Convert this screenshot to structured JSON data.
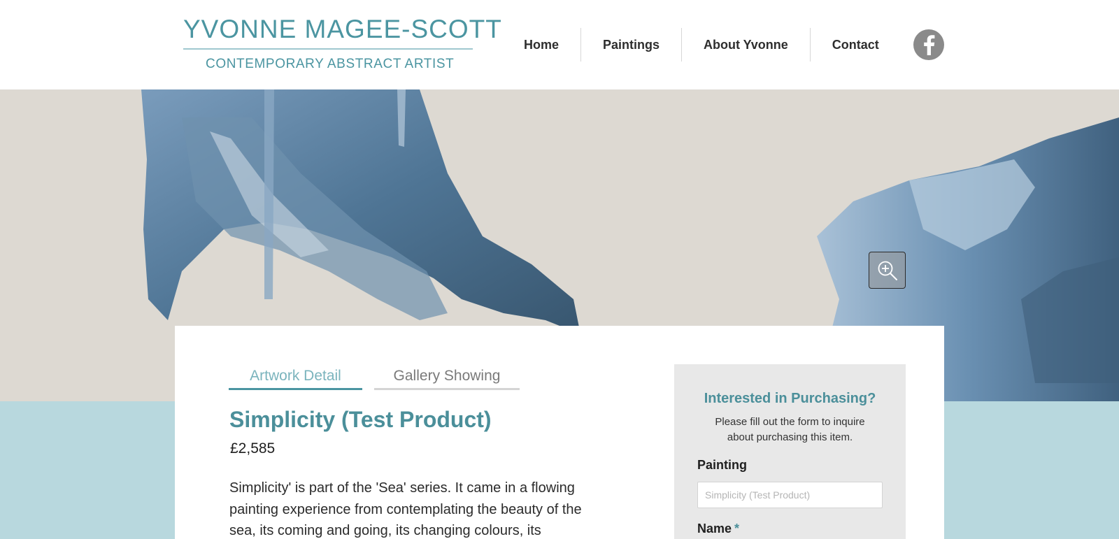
{
  "logo": {
    "title": "YVONNE MAGEE-SCOTT",
    "subtitle": "CONTEMPORARY ABSTRACT ARTIST"
  },
  "nav": {
    "items": [
      {
        "label": "Home"
      },
      {
        "label": "Paintings"
      },
      {
        "label": "About Yvonne"
      },
      {
        "label": "Contact"
      }
    ],
    "social_icon": "facebook-icon"
  },
  "hero": {
    "zoom_icon": "zoom-in-icon"
  },
  "tabs": [
    {
      "label": "Artwork Detail",
      "active": true
    },
    {
      "label": "Gallery Showing",
      "active": false
    }
  ],
  "product": {
    "title": "Simplicity (Test Product)",
    "price": "£2,585",
    "description": "Simplicity' is part of the 'Sea' series. It came in a flowing painting experience from contemplating the beauty of the sea, its coming and going, its changing colours, its"
  },
  "inquiry": {
    "title": "Interested in Purchasing?",
    "text": "Please fill out the form to inquire about purchasing this item.",
    "painting_label": "Painting",
    "painting_placeholder": "Simplicity (Test Product)",
    "name_label": "Name",
    "required_marker": "*"
  },
  "colors": {
    "brand_teal": "#4b95a1",
    "band_blue": "#b8d8de",
    "canvas_beige": "#ddd9d2",
    "paint_blue": "#5b86a6"
  }
}
